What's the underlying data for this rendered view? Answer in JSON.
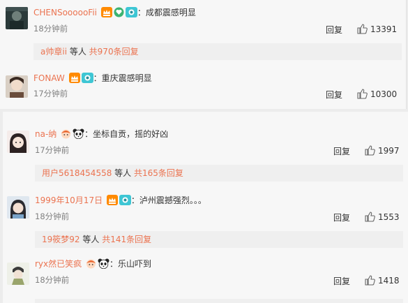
{
  "comments": [
    {
      "username": "CHENSoooooFii",
      "text": "：成都震感明显",
      "time": "18分钟前",
      "reply": "回复",
      "likes": "13391",
      "subreply": {
        "user": "a帅章ii",
        "mid": " 等人 ",
        "count": "共970条回复"
      }
    },
    {
      "username": "FONAW",
      "text": "：重庆震感明显",
      "time": "17分钟前",
      "reply": "回复",
      "likes": "10300"
    },
    {
      "username": "na-纳",
      "text": "：坐标自贡，摇的好凶",
      "time": "17分钟前",
      "reply": "回复",
      "likes": "1997",
      "subreply": {
        "user": "用户5618454558",
        "mid": " 等人 ",
        "count": "共165条回复"
      }
    },
    {
      "username": "1999年10月17日",
      "text": "：泸州震撼强烈。。。",
      "time": "18分钟前",
      "reply": "回复",
      "likes": "1553",
      "subreply": {
        "user": "19筱梦92",
        "mid": " 等人 ",
        "count": "共141条回复"
      }
    },
    {
      "username": "ryx然已笑疯",
      "text": "：乐山吓到",
      "time": "18分钟前",
      "reply": "回复",
      "likes": "1418"
    }
  ],
  "colors": {
    "username": "#eb7350",
    "panel": "#f7f7f7",
    "subreply_bg": "#efefef",
    "page_bg": "#ececec"
  },
  "icons": [
    "vip-crown-icon",
    "heart-badge-icon",
    "fan-eye-badge-icon",
    "panda-icon",
    "thumbs-up-icon"
  ]
}
